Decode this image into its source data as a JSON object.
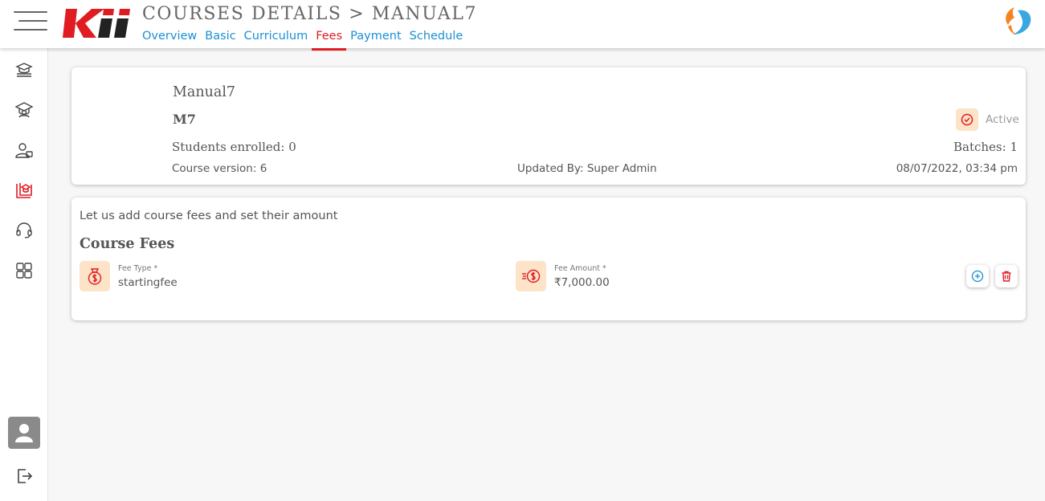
{
  "header": {
    "logo_text": "Kii",
    "title": "COURSES DETAILS > MANUAL7",
    "tabs": [
      {
        "label": "Overview",
        "active": false
      },
      {
        "label": "Basic",
        "active": false
      },
      {
        "label": "Curriculum",
        "active": false
      },
      {
        "label": "Fees",
        "active": true
      },
      {
        "label": "Payment",
        "active": false
      },
      {
        "label": "Schedule",
        "active": false
      }
    ]
  },
  "sidebar": {
    "items": [
      {
        "icon": "courses-stack-icon",
        "active": false
      },
      {
        "icon": "graduate-icon",
        "active": false
      },
      {
        "icon": "user-badge-icon",
        "active": false
      },
      {
        "icon": "course-library-icon",
        "active": true
      },
      {
        "icon": "headset-icon",
        "active": false
      },
      {
        "icon": "dashboard-grid-icon",
        "active": false
      }
    ],
    "bottom": [
      {
        "icon": "user-avatar-icon"
      },
      {
        "icon": "logout-icon"
      }
    ]
  },
  "course_card": {
    "name": "Manual7",
    "code": "M7",
    "status": "Active",
    "students_enrolled": "Students enrolled: 0",
    "batches": "Batches: 1",
    "version": "Course version: 6",
    "updated_by": "Updated By: Super Admin",
    "updated_at": "08/07/2022, 03:34 pm"
  },
  "fees": {
    "intro": "Let us add course fees and set their amount",
    "title": "Course Fees",
    "fee_type_label": "Fee Type *",
    "fee_type_value": "startingfee",
    "fee_amount_label": "Fee Amount *",
    "fee_amount_value": "₹7,000.00"
  },
  "colors": {
    "accent_red": "#e01b22",
    "link_blue": "#1a8fd6",
    "icon_bg": "#fde3c8",
    "brand_orange": "#f58220",
    "brand_blue": "#3aa7e0"
  }
}
